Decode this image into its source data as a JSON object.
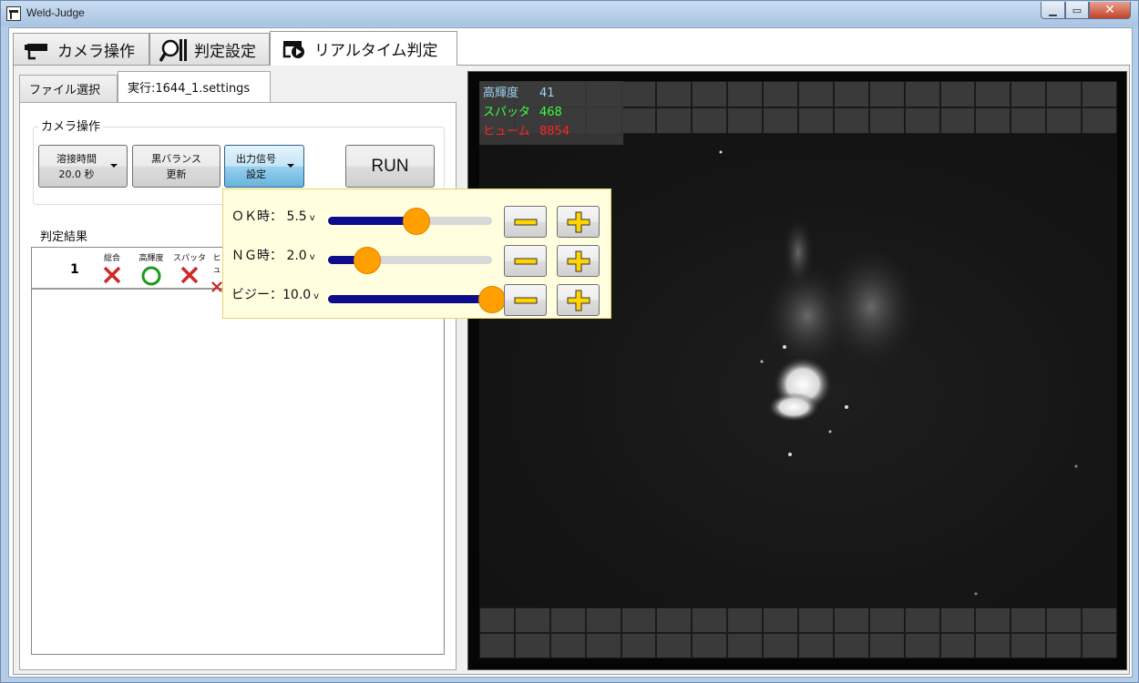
{
  "window": {
    "title": "Weld-Judge"
  },
  "main_tabs": [
    {
      "label": "カメラ操作",
      "icon": "camera-icon"
    },
    {
      "label": "判定設定",
      "icon": "magnifier-icon"
    },
    {
      "label": "リアルタイム判定",
      "icon": "camera-play-icon"
    }
  ],
  "sub_tabs": [
    {
      "label": "ファイル選択"
    },
    {
      "label": "実行:1644_1.settings"
    }
  ],
  "camera_group": {
    "label": "カメラ操作",
    "weld_time_line1": "溶接時間",
    "weld_time_line2": "20.0 秒",
    "black_balance_line1": "黒バランス",
    "black_balance_line2": "更新",
    "output_signal_line1": "出力信号",
    "output_signal_line2": "設定",
    "run_label": "RUN"
  },
  "result": {
    "label": "判定結果",
    "row_number": "1",
    "columns": [
      {
        "label": "総合",
        "mark": "cross"
      },
      {
        "label": "高輝度",
        "mark": "circle"
      },
      {
        "label": "スパッタ",
        "mark": "cross"
      },
      {
        "label": "ヒュ",
        "mark": "cross"
      }
    ]
  },
  "hud": {
    "rows": [
      {
        "key": "高輝度",
        "value": "41",
        "color": "#9fd6ef"
      },
      {
        "key": "スパッタ",
        "value": "468",
        "color": "#3cff3c"
      },
      {
        "key": "ヒューム",
        "value": "8854",
        "color": "#ff2424"
      }
    ]
  },
  "output_popup": {
    "rows": [
      {
        "label": "ＯＫ時：",
        "value": "5.5",
        "unit": "v",
        "level": 0.54
      },
      {
        "label": "ＮＧ時：",
        "value": "2.0",
        "unit": "v",
        "level": 0.24
      },
      {
        "label": "ビジー：",
        "value": "10.0",
        "unit": "v",
        "level": 1.0
      }
    ]
  },
  "colors": {
    "accent_slider": "#0c0c8c",
    "thumb": "#ffa000",
    "cross": "#d0282a",
    "circle": "#1a9a1a"
  }
}
